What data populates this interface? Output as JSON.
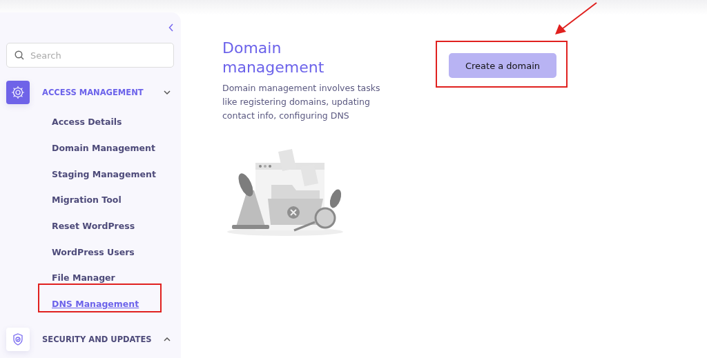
{
  "sidebar": {
    "search": {
      "placeholder": "Search"
    },
    "groups": [
      {
        "label": "ACCESS MANAGEMENT",
        "active": true,
        "expanded": true,
        "items": [
          {
            "label": "Access Details",
            "selected": false
          },
          {
            "label": "Domain Management",
            "selected": false
          },
          {
            "label": "Staging Management",
            "selected": false
          },
          {
            "label": "Migration Tool",
            "selected": false
          },
          {
            "label": "Reset WordPress",
            "selected": false
          },
          {
            "label": "WordPress Users",
            "selected": false
          },
          {
            "label": "File Manager",
            "selected": false
          },
          {
            "label": "DNS Management",
            "selected": true
          }
        ]
      },
      {
        "label": "SECURITY AND UPDATES",
        "active": false,
        "expanded": false
      }
    ]
  },
  "main": {
    "title": "Domain management",
    "description": "Domain management involves tasks like registering domains, updating contact info, configuring DNS",
    "button": "Create a domain"
  }
}
